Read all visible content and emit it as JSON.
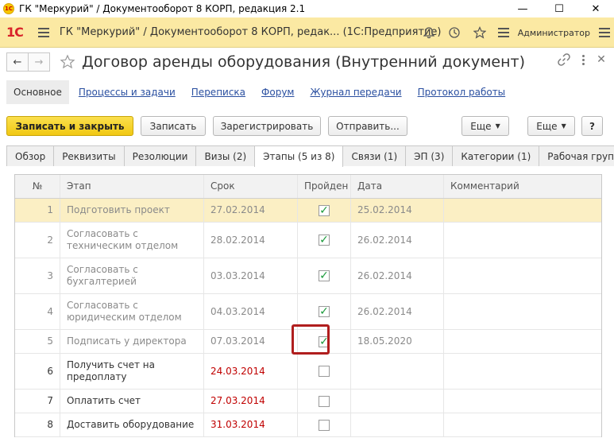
{
  "window": {
    "title": "ГК \"Меркурий\" / Документооборот 8 КОРП, редакция 2.1",
    "minimize": "—",
    "maximize": "☐",
    "close": "✕"
  },
  "appbar": {
    "logo": "1С",
    "title": "ГК \"Меркурий\" / Документооборот 8 КОРП, редак...  (1С:Предприятие)",
    "user": "Администратор"
  },
  "document": {
    "title": "Договор аренды оборудования (Внутренний документ)"
  },
  "sections": {
    "active": "Основное",
    "links": [
      "Процессы и задачи",
      "Переписка",
      "Форум",
      "Журнал передачи",
      "Протокол работы"
    ]
  },
  "toolbar": {
    "save_close": "Записать и закрыть",
    "save": "Записать",
    "register": "Зарегистрировать",
    "send": "Отправить...",
    "more1": "Еще",
    "more2": "Еще",
    "help": "?"
  },
  "tabs": [
    "Обзор",
    "Реквизиты",
    "Резолюции",
    "Визы (2)",
    "Этапы (5 из 8)",
    "Связи (1)",
    "ЭП (3)",
    "Категории (1)",
    "Рабочая группа"
  ],
  "active_tab_index": 4,
  "table": {
    "columns": [
      "№",
      "Этап",
      "Срок",
      "Пройден",
      "Дата",
      "Комментарий"
    ],
    "rows": [
      {
        "num": "1",
        "stage": "Подготовить проект",
        "due": "27.02.2014",
        "done": true,
        "date": "25.02.2014",
        "comment": ""
      },
      {
        "num": "2",
        "stage": "Согласовать с техническим отделом",
        "due": "28.02.2014",
        "done": true,
        "date": "26.02.2014",
        "comment": ""
      },
      {
        "num": "3",
        "stage": "Согласовать с бухгалтерией",
        "due": "03.03.2014",
        "done": true,
        "date": "26.02.2014",
        "comment": ""
      },
      {
        "num": "4",
        "stage": "Согласовать с юридическим отделом",
        "due": "04.03.2014",
        "done": true,
        "date": "26.02.2014",
        "comment": ""
      },
      {
        "num": "5",
        "stage": "Подписать у директора",
        "due": "07.03.2014",
        "done": true,
        "date": "18.05.2020",
        "comment": ""
      },
      {
        "num": "6",
        "stage": "Получить счет на предоплату",
        "due": "24.03.2014",
        "done": false,
        "date": "",
        "comment": ""
      },
      {
        "num": "7",
        "stage": "Оплатить счет",
        "due": "27.03.2014",
        "done": false,
        "date": "",
        "comment": ""
      },
      {
        "num": "8",
        "stage": "Доставить оборудование",
        "due": "31.03.2014",
        "done": false,
        "date": "",
        "comment": ""
      }
    ]
  },
  "colors": {
    "accent_yellow": "#f1c813",
    "header_bar": "#fbe9a3",
    "selected_row": "#fbefc4",
    "overdue_red": "#c00000",
    "check_green": "#1b9a3b",
    "highlight_border": "#b01e1e"
  }
}
